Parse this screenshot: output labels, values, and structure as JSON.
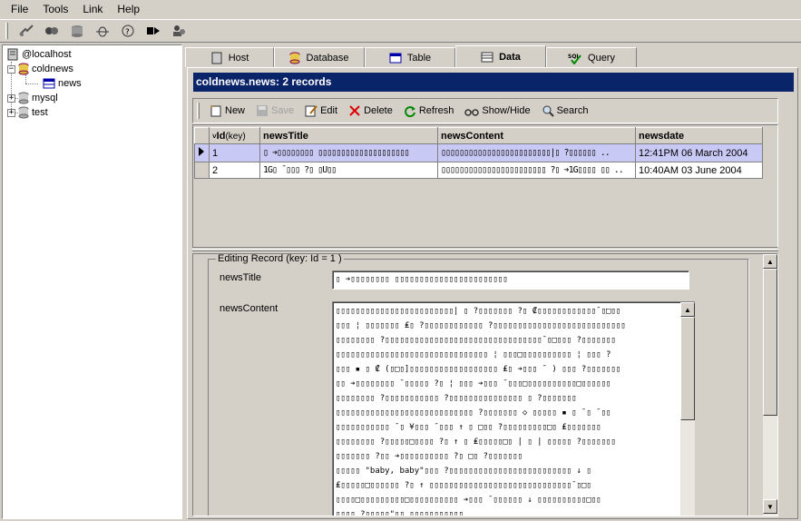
{
  "menu": {
    "file": "File",
    "tools": "Tools",
    "link": "Link",
    "help": "Help"
  },
  "toolbar": {
    "icons": [
      "connect-icon",
      "disconnect-icon",
      "database-icon",
      "bug-icon",
      "refresh-icon",
      "run-icon",
      "users-icon"
    ]
  },
  "tree": {
    "root": "@localhost",
    "db1": "coldnews",
    "db1_table": "news",
    "db2": "mysql",
    "db3": "test"
  },
  "tabs": {
    "host": "Host",
    "database": "Database",
    "table": "Table",
    "data": "Data",
    "query": "Query"
  },
  "panel_title": "coldnews.news: 2 records",
  "data_toolbar": {
    "new": "New",
    "save": "Save",
    "edit": "Edit",
    "delete": "Delete",
    "refresh": "Refresh",
    "showhide": "Show/Hide",
    "search": "Search"
  },
  "grid": {
    "headers": {
      "id": "Id",
      "id_key": "(key)",
      "title": "newsTitle",
      "content": "newsContent",
      "date": "newsdate"
    },
    "rows": [
      {
        "id": "1",
        "title": "▯ ➔▯▯▯▯▯▯▯▯ ▯▯▯▯▯▯▯▯▯▯▯▯▯▯▯▯▯▯▯▯",
        "content": "▯▯▯▯▯▯▯▯▯▯▯▯▯▯▯▯▯▯▯▯▯▯▯▯|▯ ?▯▯▯▯▯▯ ..",
        "date": "12:41PM 06 March 2004"
      },
      {
        "id": "2",
        "title": "1G▯ ¯▯▯▯ ?▯ ▯U▯▯",
        "content": "▯▯▯▯▯▯▯▯▯▯▯▯▯▯▯▯▯▯▯▯▯▯▯ ?▯ ➔1G▯▯▯▯ ▯▯ ..",
        "date": "10:40AM 03 June 2004"
      }
    ]
  },
  "editor": {
    "legend": "Editing Record (key: Id = 1 )",
    "label_title": "newsTitle",
    "label_content": "newsContent",
    "title_value": "▯ ➔▯▯▯▯▯▯▯▯ ▯▯▯▯▯▯▯▯▯▯▯▯▯▯▯▯▯▯▯▯▯▯▯",
    "content_lines": [
      "▯▯▯▯▯▯▯▯▯▯▯▯▯▯▯▯▯▯▯▯▯▯▯▯| ▯ ?▯▯▯▯▯▯▯ ?▯ ₡▯▯▯▯▯▯▯▯▯▯▯▯¯▯□▯▯",
      "▯▯▯ ¦ ▯▯▯▯▯▯▯ ₤▯ ?▯▯▯▯▯▯▯▯▯▯▯▯ ?▯▯▯▯▯▯▯▯▯▯▯▯▯▯▯▯▯▯▯▯▯▯▯▯▯▯▯",
      "▯▯▯▯▯▯▯▯ ?▯▯▯▯▯▯▯▯▯▯▯▯▯▯▯▯▯▯▯▯▯▯▯▯▯▯▯▯▯▯▯▯¯▯□▯▯▯ ?▯▯▯▯▯▯▯",
      "▯▯▯▯▯▯▯▯▯▯▯▯▯▯▯▯▯▯▯▯▯▯▯▯▯▯▯▯▯▯▯ ¦ ▯▯▯□▯▯▯▯▯▯▯▯▯▯ ¦ ▯▯▯ ?",
      "▯▯▯ ▪ ▯ ₡ (▯□▯]▯▯▯▯▯▯▯▯▯▯▯▯▯▯▯▯▯▯ ₤▯ ➔▯▯▯ ¯ ) ▯▯▯ ?▯▯▯▯▯▯▯",
      "▯▯ ➔▯▯▯▯▯▯▯▯ ¯▯▯▯▯▯ ?▯ ¦ ▯▯▯ ➔▯▯▯ ¯▯▯▯□▯▯▯▯▯▯▯▯▯▯□▯▯▯▯▯▯",
      "▯▯▯▯▯▯▯▯ ?▯▯▯▯▯▯▯▯▯▯▯ ?▯▯▯▯▯▯▯▯▯▯▯▯▯▯▯ ▯ ?▯▯▯▯▯▯▯",
      "▯▯▯▯▯▯▯▯▯▯▯▯▯▯▯▯▯▯▯▯▯▯▯▯▯▯▯▯ ?▯▯▯▯▯▯▯ ◇ ▯▯▯▯▯ ▪ ▯ ¯▯ ¯▯▯",
      "▯▯▯▯▯▯▯▯▯▯▯ ¯▯ ¥▯▯▯ ¯▯▯▯ ↑ ▯ □▯▯ ?▯▯▯▯▯▯▯▯▯□▯ ₤▯▯▯▯▯▯▯",
      "▯▯▯▯▯▯▯▯ ?▯▯▯▯▯□▯▯▯▯ ?▯ ↑ ▯ ₤▯▯▯▯▯□▯ | ▯ | ▯▯▯▯▯ ?▯▯▯▯▯▯▯",
      "▯▯▯▯▯▯▯ ?▯▯ ➔▯▯▯▯▯▯▯▯▯▯ ?▯ □▯ ?▯▯▯▯▯▯▯",
      "▯▯▯▯▯ \"baby, baby\"▯▯▯ ?▯▯▯▯▯▯▯▯▯▯▯▯▯▯▯▯▯▯▯▯▯▯▯▯▯ ↓ ▯",
      "₤▯▯▯▯▯□▯▯▯▯▯▯ ?▯ ↑ ▯▯▯▯▯▯▯▯▯▯▯▯▯▯▯▯▯▯▯▯▯▯▯▯▯▯▯▯▯¯▯□▯",
      "▯▯▯▯□▯▯▯▯▯▯▯▯▯□▯▯▯▯▯▯▯▯▯▯ ➔▯▯▯ ¯▯▯▯▯▯▯ ↓ ▯▯▯▯▯▯▯▯▯▯□▯▯",
      "▯▯▯▯ ?▯▯▯▯▯\"▯▯ ▯▯▯▯▯▯▯▯▯▯▯"
    ]
  },
  "colors": {
    "titlebar": "#0a246a",
    "selected_row": "#c9c9f5",
    "chrome": "#d4d0c8"
  }
}
